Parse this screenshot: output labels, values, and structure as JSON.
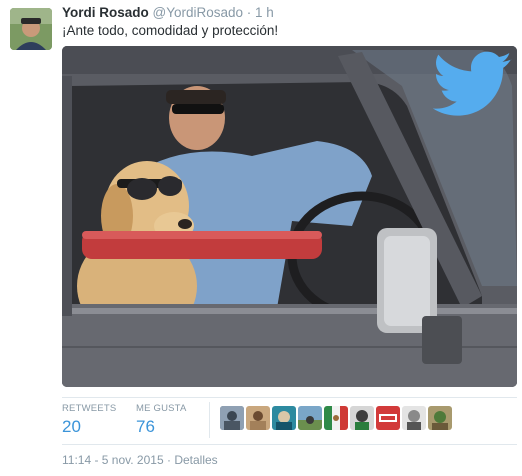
{
  "tweet": {
    "display_name": "Yordi Rosado",
    "handle": "@YordiRosado",
    "separator": " · ",
    "time_ago": "1 h",
    "text": "¡Ante todo, comodidad y protección!"
  },
  "stats": {
    "retweets_label": "RETWEETS",
    "retweets_count": "20",
    "favorites_label": "ME GUSTA",
    "favorites_count": "76"
  },
  "footer": {
    "timestamp": "11:14 - 5 nov. 2015",
    "separator": " · ",
    "details_label": "Detalles"
  },
  "colors": {
    "brand_blue": "#3b94d9",
    "twitter_bird": "#55acee",
    "muted_text": "#8899a6",
    "divider": "#e1e8ed"
  },
  "icons": {
    "media_overlay": "twitter-bird-icon"
  }
}
